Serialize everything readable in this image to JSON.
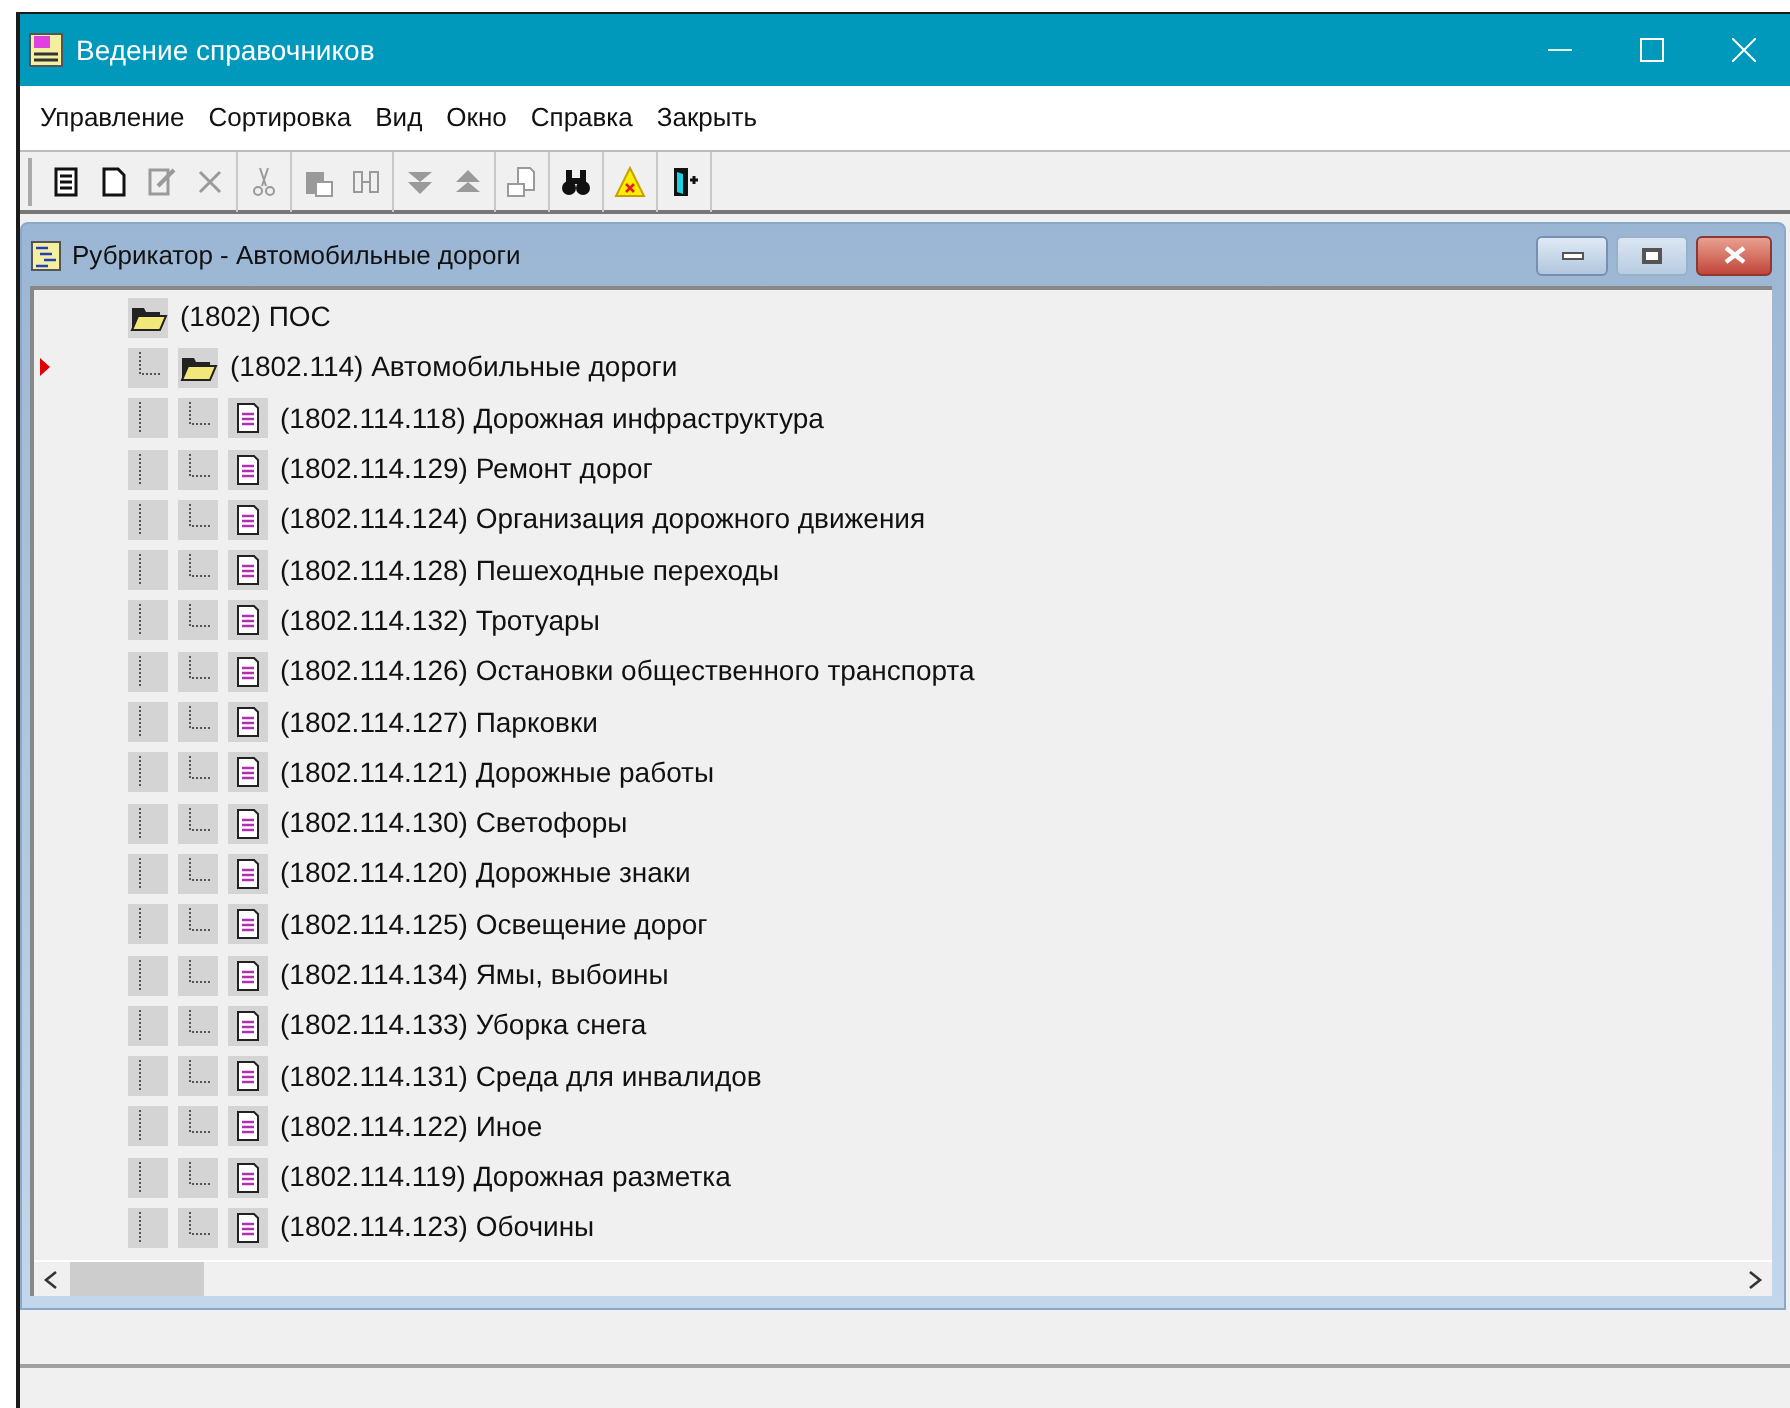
{
  "window": {
    "title": "Ведение справочников"
  },
  "menu": [
    "Управление",
    "Сортировка",
    "Вид",
    "Окно",
    "Справка",
    "Закрыть"
  ],
  "toolbar": [
    [
      {
        "kind": "document",
        "disabled": false
      },
      {
        "kind": "blank",
        "disabled": false
      },
      {
        "kind": "edit",
        "disabled": true
      },
      {
        "kind": "delete",
        "disabled": true
      }
    ],
    [
      {
        "kind": "cut",
        "disabled": true
      }
    ],
    [
      {
        "kind": "paste",
        "disabled": true
      },
      {
        "kind": "columns",
        "disabled": true
      }
    ],
    [
      {
        "kind": "down",
        "disabled": true
      },
      {
        "kind": "up",
        "disabled": true
      }
    ],
    [
      {
        "kind": "stamp",
        "disabled": true
      }
    ],
    [
      {
        "kind": "find",
        "disabled": false
      }
    ],
    [
      {
        "kind": "warning",
        "disabled": false
      }
    ],
    [
      {
        "kind": "exit",
        "disabled": false
      }
    ]
  ],
  "child_window": {
    "title": "Рубрикатор - Автомобильные дороги"
  },
  "tree": [
    {
      "label": "(1802) ПОС",
      "kind": "folder",
      "selected": false,
      "expanded": true,
      "children": [
        {
          "label": "(1802.114) Автомобильные дороги",
          "kind": "folder",
          "selected": true,
          "expanded": true,
          "children": [
            {
              "label": "(1802.114.118) Дорожная инфраструктура",
              "kind": "leaf",
              "selected": false
            },
            {
              "label": "(1802.114.129) Ремонт дорог",
              "kind": "leaf",
              "selected": false
            },
            {
              "label": "(1802.114.124) Организация дорожного движения",
              "kind": "leaf",
              "selected": false
            },
            {
              "label": "(1802.114.128) Пешеходные переходы",
              "kind": "leaf",
              "selected": false
            },
            {
              "label": "(1802.114.132) Тротуары",
              "kind": "leaf",
              "selected": false
            },
            {
              "label": "(1802.114.126) Остановки общественного транспорта",
              "kind": "leaf",
              "selected": false
            },
            {
              "label": "(1802.114.127) Парковки",
              "kind": "leaf",
              "selected": false
            },
            {
              "label": "(1802.114.121) Дорожные работы",
              "kind": "leaf",
              "selected": false
            },
            {
              "label": "(1802.114.130) Светофоры",
              "kind": "leaf",
              "selected": false
            },
            {
              "label": "(1802.114.120) Дорожные знаки",
              "kind": "leaf",
              "selected": false
            },
            {
              "label": "(1802.114.125) Освещение дорог",
              "kind": "leaf",
              "selected": false
            },
            {
              "label": "(1802.114.134) Ямы, выбоины",
              "kind": "leaf",
              "selected": false
            },
            {
              "label": "(1802.114.133) Уборка снега",
              "kind": "leaf",
              "selected": false
            },
            {
              "label": "(1802.114.131) Среда для инвалидов",
              "kind": "leaf",
              "selected": false
            },
            {
              "label": "(1802.114.122) Иное",
              "kind": "leaf",
              "selected": false
            },
            {
              "label": "(1802.114.119) Дорожная разметка",
              "kind": "leaf",
              "selected": false
            },
            {
              "label": "(1802.114.123) Обочины",
              "kind": "leaf",
              "selected": false
            }
          ]
        }
      ]
    }
  ]
}
